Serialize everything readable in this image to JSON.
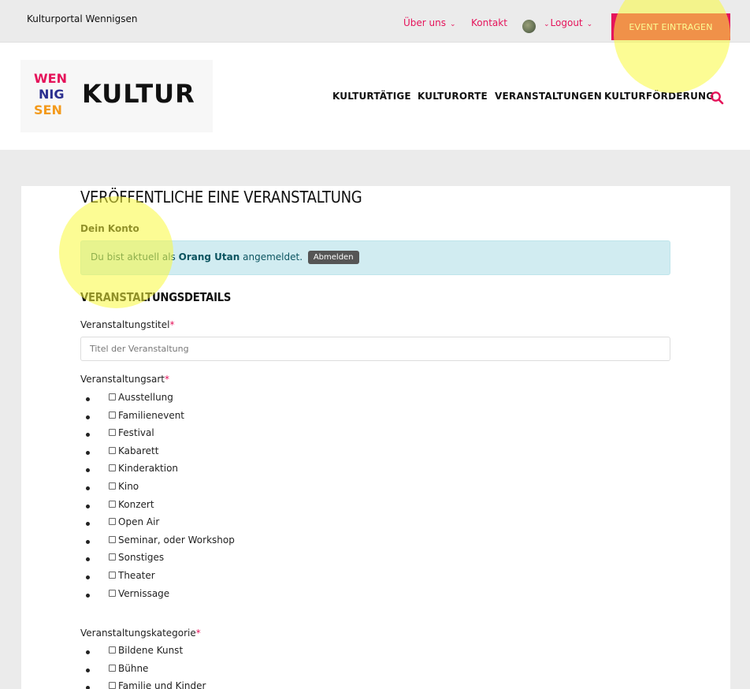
{
  "topbar": {
    "site_name": "Kulturportal Wennigsen",
    "nav": [
      "Über uns",
      "Kontakt",
      "Logout"
    ],
    "chevron": "⌄",
    "cta_label": "EVENT EINTRAGEN"
  },
  "header": {
    "logo_letters": [
      "WEN",
      "NIG",
      "SEN"
    ],
    "logo_word": "KULTUR",
    "nav": [
      "KULTURTÄTIGE",
      "KULTURORTE",
      "VERANSTALTUNGEN",
      "KULTURFÖRDERUNG"
    ]
  },
  "colors": {
    "accent": "#e5135a",
    "alert_bg": "#d1ecf1",
    "alert_text": "#0c5460"
  },
  "form": {
    "page_title": "VERÖFFENTLICHE EINE VERANSTALTUNG",
    "account_heading": "Dein Konto",
    "alert": {
      "prefix": "Du bist aktuell als",
      "user": "Orang Utan",
      "suffix": "angemeldet.",
      "logout_button": "Abmelden"
    },
    "section_heading": "VERANSTALTUNGSDETAILS",
    "title_field": {
      "label": "Veranstaltungstitel",
      "required": "*",
      "placeholder": "Titel der Veranstaltung"
    },
    "type_field": {
      "label": "Veranstaltungsart",
      "required": "*",
      "options": [
        "Ausstellung",
        "Familienevent",
        "Festival",
        "Kabarett",
        "Kinderaktion",
        "Kino",
        "Konzert",
        "Open Air",
        "Seminar, oder Workshop",
        "Sonstiges",
        "Theater",
        "Vernissage"
      ]
    },
    "category_field": {
      "label": "Veranstaltungskategorie",
      "required": "*",
      "options": [
        "Bildene Kunst",
        "Bühne",
        "Familie und Kinder"
      ]
    }
  }
}
